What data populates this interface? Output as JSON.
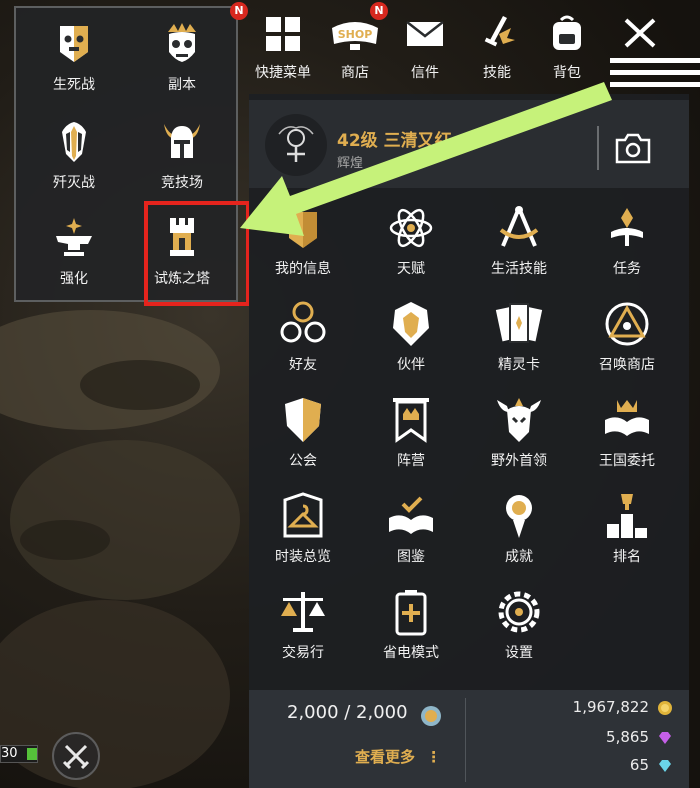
{
  "quick_menu": {
    "items": [
      {
        "label": "生死战",
        "icon": "skull-banner-icon"
      },
      {
        "label": "副本",
        "icon": "crowned-skull-icon"
      },
      {
        "label": "歼灭战",
        "icon": "sword-crest-icon"
      },
      {
        "label": "竞技场",
        "icon": "horned-helmet-icon"
      },
      {
        "label": "强化",
        "icon": "anvil-icon"
      },
      {
        "label": "试炼之塔",
        "icon": "tower-icon"
      }
    ],
    "badge": "N"
  },
  "topbar": {
    "items": [
      {
        "label": "快捷菜单",
        "icon": "grid-menu-icon"
      },
      {
        "label": "商店",
        "icon": "shop-icon",
        "badge": "N",
        "sign": "SHOP"
      },
      {
        "label": "信件",
        "icon": "mail-icon"
      },
      {
        "label": "技能",
        "icon": "sword-skill-icon"
      },
      {
        "label": "背包",
        "icon": "backpack-icon"
      }
    ],
    "close_icon": "close-icon"
  },
  "profile": {
    "level": "42级",
    "name": "三清又红",
    "title": "辉煌"
  },
  "menu_grid": [
    {
      "label": "我的信息",
      "icon": "info-icon"
    },
    {
      "label": "天赋",
      "icon": "atom-icon"
    },
    {
      "label": "生活技能",
      "icon": "compass-icon"
    },
    {
      "label": "任务",
      "icon": "quest-icon"
    },
    {
      "label": "好友",
      "icon": "friends-icon"
    },
    {
      "label": "伙伴",
      "icon": "lion-icon"
    },
    {
      "label": "精灵卡",
      "icon": "cards-icon"
    },
    {
      "label": "召唤商店",
      "icon": "eye-triangle-icon"
    },
    {
      "label": "公会",
      "icon": "shield-icon"
    },
    {
      "label": "阵营",
      "icon": "banner-icon"
    },
    {
      "label": "野外首领",
      "icon": "boss-icon"
    },
    {
      "label": "王国委托",
      "icon": "crown-book-icon"
    },
    {
      "label": "时装总览",
      "icon": "hanger-icon"
    },
    {
      "label": "图鉴",
      "icon": "book-check-icon"
    },
    {
      "label": "成就",
      "icon": "medal-icon"
    },
    {
      "label": "排名",
      "icon": "podium-icon"
    },
    {
      "label": "交易行",
      "icon": "scale-icon"
    },
    {
      "label": "省电模式",
      "icon": "battery-icon"
    },
    {
      "label": "设置",
      "icon": "gear-icon"
    }
  ],
  "footer": {
    "stamina": "2,000 / 2,000",
    "more": "查看更多",
    "gold": "1,967,822",
    "purple_gem": "5,865",
    "blue_gem": "65"
  },
  "hud": {
    "value": "30"
  },
  "colors": {
    "accent_gold": "#e0ae50",
    "highlight_red": "#e5241d",
    "arrow_green": "#c6f27a"
  }
}
